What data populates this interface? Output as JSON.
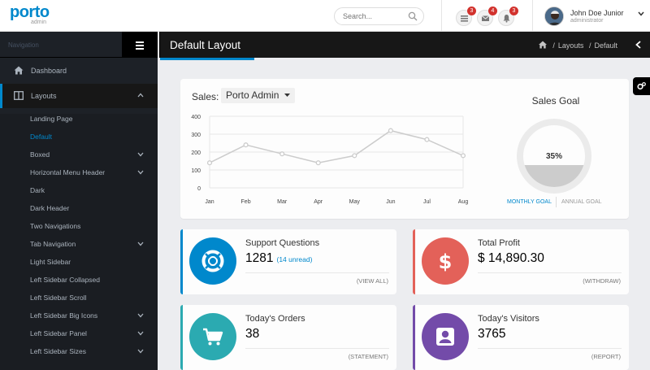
{
  "header": {
    "brand": "porto",
    "brand_sub": "admin",
    "search_placeholder": "Search...",
    "notifications": [
      {
        "icon": "tasks-icon",
        "count": "3"
      },
      {
        "icon": "envelope-icon",
        "count": "4"
      },
      {
        "icon": "bell-icon",
        "count": "3"
      }
    ],
    "user": {
      "name": "John Doe Junior",
      "role": "administrator"
    }
  },
  "sidebar": {
    "heading": "Navigation",
    "items": [
      {
        "label": "Dashboard",
        "icon": "home-icon"
      },
      {
        "label": "Layouts",
        "icon": "columns-icon"
      }
    ],
    "subitems": [
      {
        "label": "Landing Page",
        "has_children": false
      },
      {
        "label": "Default",
        "has_children": false,
        "active": true
      },
      {
        "label": "Boxed",
        "has_children": true
      },
      {
        "label": "Horizontal Menu Header",
        "has_children": true
      },
      {
        "label": "Dark",
        "has_children": false
      },
      {
        "label": "Dark Header",
        "has_children": false
      },
      {
        "label": "Two Navigations",
        "has_children": false
      },
      {
        "label": "Tab Navigation",
        "has_children": true
      },
      {
        "label": "Light Sidebar",
        "has_children": false
      },
      {
        "label": "Left Sidebar Collapsed",
        "has_children": false
      },
      {
        "label": "Left Sidebar Scroll",
        "has_children": false
      },
      {
        "label": "Left Sidebar Big Icons",
        "has_children": true
      },
      {
        "label": "Left Sidebar Panel",
        "has_children": true
      },
      {
        "label": "Left Sidebar Sizes",
        "has_children": true
      }
    ]
  },
  "page": {
    "title": "Default Layout",
    "breadcrumbs": [
      "Layouts",
      "Default"
    ]
  },
  "sales": {
    "label": "Sales:",
    "selected": "Porto Admin"
  },
  "chart_data": {
    "type": "line",
    "categories": [
      "Jan",
      "Feb",
      "Mar",
      "Apr",
      "May",
      "Jun",
      "Jul",
      "Aug"
    ],
    "series": [
      {
        "values": [
          140,
          240,
          190,
          140,
          180,
          320,
          270,
          180
        ]
      }
    ],
    "ylim": [
      0,
      400
    ],
    "yticks": [
      0,
      100,
      200,
      300,
      400
    ],
    "grid": true,
    "color": "#cccccc"
  },
  "goal": {
    "title": "Sales Goal",
    "percent_label": "35%",
    "fraction": 0.35,
    "tab_monthly": "MONTHLY GOAL",
    "tab_annual": "ANNUAL GOAL"
  },
  "cards": [
    {
      "title": "Support Questions",
      "value": "1281",
      "sub": "(14 unread)",
      "link": "(VIEW ALL)",
      "color": "#0088cc",
      "icon": "life-ring-icon"
    },
    {
      "title": "Total Profit",
      "value": "$ 14,890.30",
      "sub": "",
      "link": "(WITHDRAW)",
      "color": "#e36159",
      "icon": "dollar-icon"
    },
    {
      "title": "Today's Orders",
      "value": "38",
      "sub": "",
      "link": "(STATEMENT)",
      "color": "#2baab1",
      "icon": "shopping-cart-icon"
    },
    {
      "title": "Today's Visitors",
      "value": "3765",
      "sub": "",
      "link": "(REPORT)",
      "color": "#734ba9",
      "icon": "user-icon"
    }
  ]
}
